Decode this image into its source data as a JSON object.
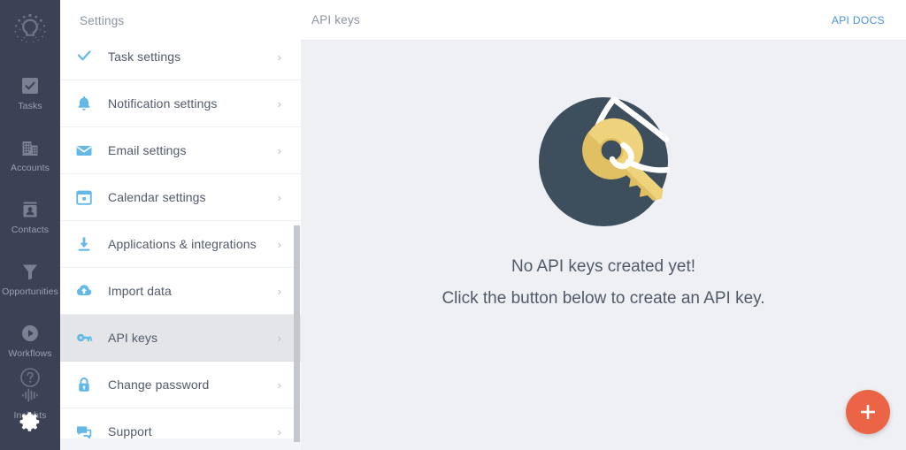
{
  "rail": {
    "logo_icon": "bulb-logo-icon",
    "items": [
      {
        "label": "Tasks",
        "icon": "check-square-icon"
      },
      {
        "label": "Accounts",
        "icon": "building-icon"
      },
      {
        "label": "Contacts",
        "icon": "contact-card-icon"
      },
      {
        "label": "Opportunities",
        "icon": "funnel-icon"
      },
      {
        "label": "Workflows",
        "icon": "play-circle-icon"
      },
      {
        "label": "Insights",
        "icon": "audio-bars-icon"
      }
    ],
    "bottom": [
      {
        "label": "Help",
        "icon": "help-circle-icon"
      },
      {
        "label": "Settings",
        "icon": "gear-icon"
      }
    ],
    "bg_color": "#3b4256",
    "label_color": "#9aa0b0"
  },
  "settings": {
    "title": "Settings",
    "selected": "API keys",
    "chevron": "›",
    "items": [
      {
        "label": "Task settings",
        "icon": "check-circle-icon",
        "selected": false
      },
      {
        "label": "Notification settings",
        "icon": "bell-icon",
        "selected": false
      },
      {
        "label": "Email settings",
        "icon": "envelope-icon",
        "selected": false
      },
      {
        "label": "Calendar settings",
        "icon": "calendar-icon",
        "selected": false
      },
      {
        "label": "Applications & integrations",
        "icon": "download-icon",
        "selected": false
      },
      {
        "label": "Import data",
        "icon": "cloud-upload-icon",
        "selected": false
      },
      {
        "label": "API keys",
        "icon": "key-icon",
        "selected": true
      },
      {
        "label": "Change password",
        "icon": "lock-icon",
        "selected": false
      },
      {
        "label": "Support",
        "icon": "chat-bubbles-icon",
        "selected": false
      }
    ],
    "icon_color": "#63b8e8",
    "selected_bg": "#e3e5e8"
  },
  "main": {
    "title": "API keys",
    "api_docs_label": "API DOCS",
    "api_docs_color": "#4a90e2",
    "empty": {
      "illustration": "key-circle-illustration",
      "circle_color": "#3d4e5c",
      "key_color": "#efd27c",
      "string_color": "#ffffff",
      "line1": "No API keys created yet!",
      "line2": "Click the button below to create an API key."
    },
    "fab": {
      "icon": "plus-icon",
      "label": "+",
      "color": "#ec6446"
    },
    "background": "#eef0f4"
  }
}
